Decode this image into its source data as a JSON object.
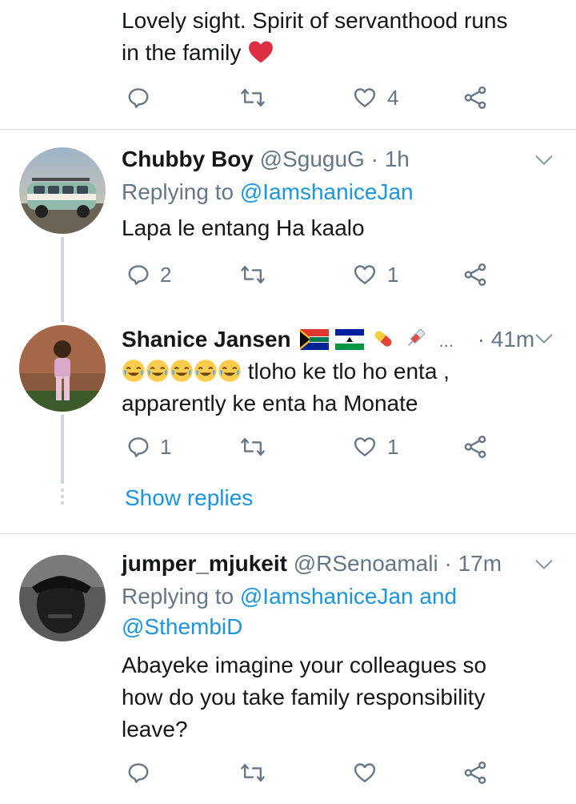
{
  "tweet0": {
    "text": "Lovely sight. Spirit of servanthood runs",
    "text2": "in the family",
    "emoji": "red-heart",
    "like_count": "4"
  },
  "tweet1": {
    "name": "Chubby Boy",
    "handle": "@SguguG",
    "time": "· 1h",
    "replying_prefix": "Replying to ",
    "replying_to": "@IamshaniceJan",
    "text": "Lapa le entang Ha kaalo",
    "reply_count": "2",
    "like_count": "1"
  },
  "tweet2": {
    "name": "Shanice Jansen",
    "name_emojis": [
      "south-africa-flag",
      "lesotho-flag",
      "pill",
      "syringe"
    ],
    "ellipsis": "...",
    "time": "· 41m",
    "text_emojis": [
      "joy",
      "joy",
      "joy",
      "joy",
      "joy"
    ],
    "text": " tloho ke tlo ho enta ,",
    "text2": "apparently ke enta ha Monate",
    "reply_count": "1",
    "like_count": "1",
    "show_replies": "Show replies"
  },
  "tweet3": {
    "name": "jumper_mjukeit",
    "handle": "@RSenoamali",
    "time": "· 17m",
    "replying_prefix": "Replying to ",
    "replying_to": "@IamshaniceJan and",
    "replying_to2": "@SthembiD",
    "text": "Abayeke imagine your colleagues so",
    "text2": "how do you take family responsibility",
    "text3": "leave?"
  },
  "colors": {
    "link": "#1b95e0",
    "secondary": "#657786",
    "divider": "#d6dbdf",
    "heart": "#e0245e"
  }
}
